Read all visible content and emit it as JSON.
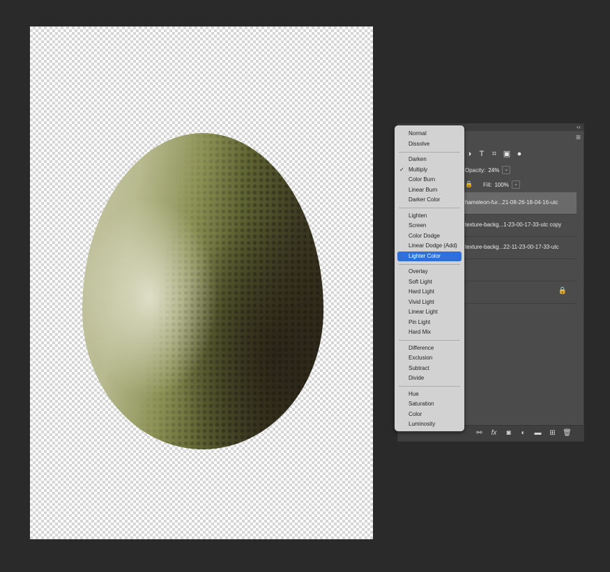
{
  "canvas": {
    "subject": "textured-egg",
    "colors": {
      "canvas_bg": "#ffffff",
      "checker": "#d6d6d6",
      "egg_light": "#c8c8a8",
      "egg_dark": "#2b2618"
    }
  },
  "blend_menu": {
    "groups": [
      [
        {
          "label": "Normal"
        },
        {
          "label": "Dissolve"
        }
      ],
      [
        {
          "label": "Darken"
        },
        {
          "label": "Multiply",
          "checked": true
        },
        {
          "label": "Color Burn"
        },
        {
          "label": "Linear Burn"
        },
        {
          "label": "Darker Color"
        }
      ],
      [
        {
          "label": "Lighten"
        },
        {
          "label": "Screen"
        },
        {
          "label": "Color Dodge"
        },
        {
          "label": "Linear Dodge (Add)"
        },
        {
          "label": "Lighter Color",
          "highlighted": true
        }
      ],
      [
        {
          "label": "Overlay"
        },
        {
          "label": "Soft Light"
        },
        {
          "label": "Hard Light"
        },
        {
          "label": "Vivid Light"
        },
        {
          "label": "Linear Light"
        },
        {
          "label": "Pin Light"
        },
        {
          "label": "Hard Mix"
        }
      ],
      [
        {
          "label": "Difference"
        },
        {
          "label": "Exclusion"
        },
        {
          "label": "Subtract"
        },
        {
          "label": "Divide"
        }
      ],
      [
        {
          "label": "Hue"
        },
        {
          "label": "Saturation"
        },
        {
          "label": "Color"
        },
        {
          "label": "Luminosity"
        }
      ]
    ],
    "check_glyph": "✓",
    "highlight_color": "#2f6fdc"
  },
  "layers_panel": {
    "collapse_glyph": "‹‹",
    "menu_glyph": "≡",
    "filter_icons": [
      "◑",
      "T",
      "⌗",
      "▣",
      "●"
    ],
    "opacity": {
      "label": "Opacity:",
      "value": "24%"
    },
    "fill": {
      "label": "Fill:",
      "value": "100%"
    },
    "dropdown_glyph": "⌄",
    "lock_glyph": "🔒",
    "layers": [
      {
        "name": "hameleon-fur...21-08-26-18-04-16-utc",
        "selected": true
      },
      {
        "name": "texture-backg...1-23-00-17-33-utc copy"
      },
      {
        "name": "texture-backg...22-11-23-00-17-33-utc"
      },
      {
        "name": ""
      },
      {
        "name": "",
        "locked": true
      }
    ],
    "bottom_tools": [
      {
        "name": "link-icon",
        "glyph": "⚯"
      },
      {
        "name": "fx-icon",
        "glyph": "fx"
      },
      {
        "name": "mask-icon",
        "glyph": "◙"
      },
      {
        "name": "adjustment-icon",
        "glyph": "◐"
      },
      {
        "name": "folder-icon",
        "glyph": "▬"
      },
      {
        "name": "new-layer-icon",
        "glyph": "⊞"
      },
      {
        "name": "trash-icon",
        "glyph": "🗑"
      }
    ]
  }
}
